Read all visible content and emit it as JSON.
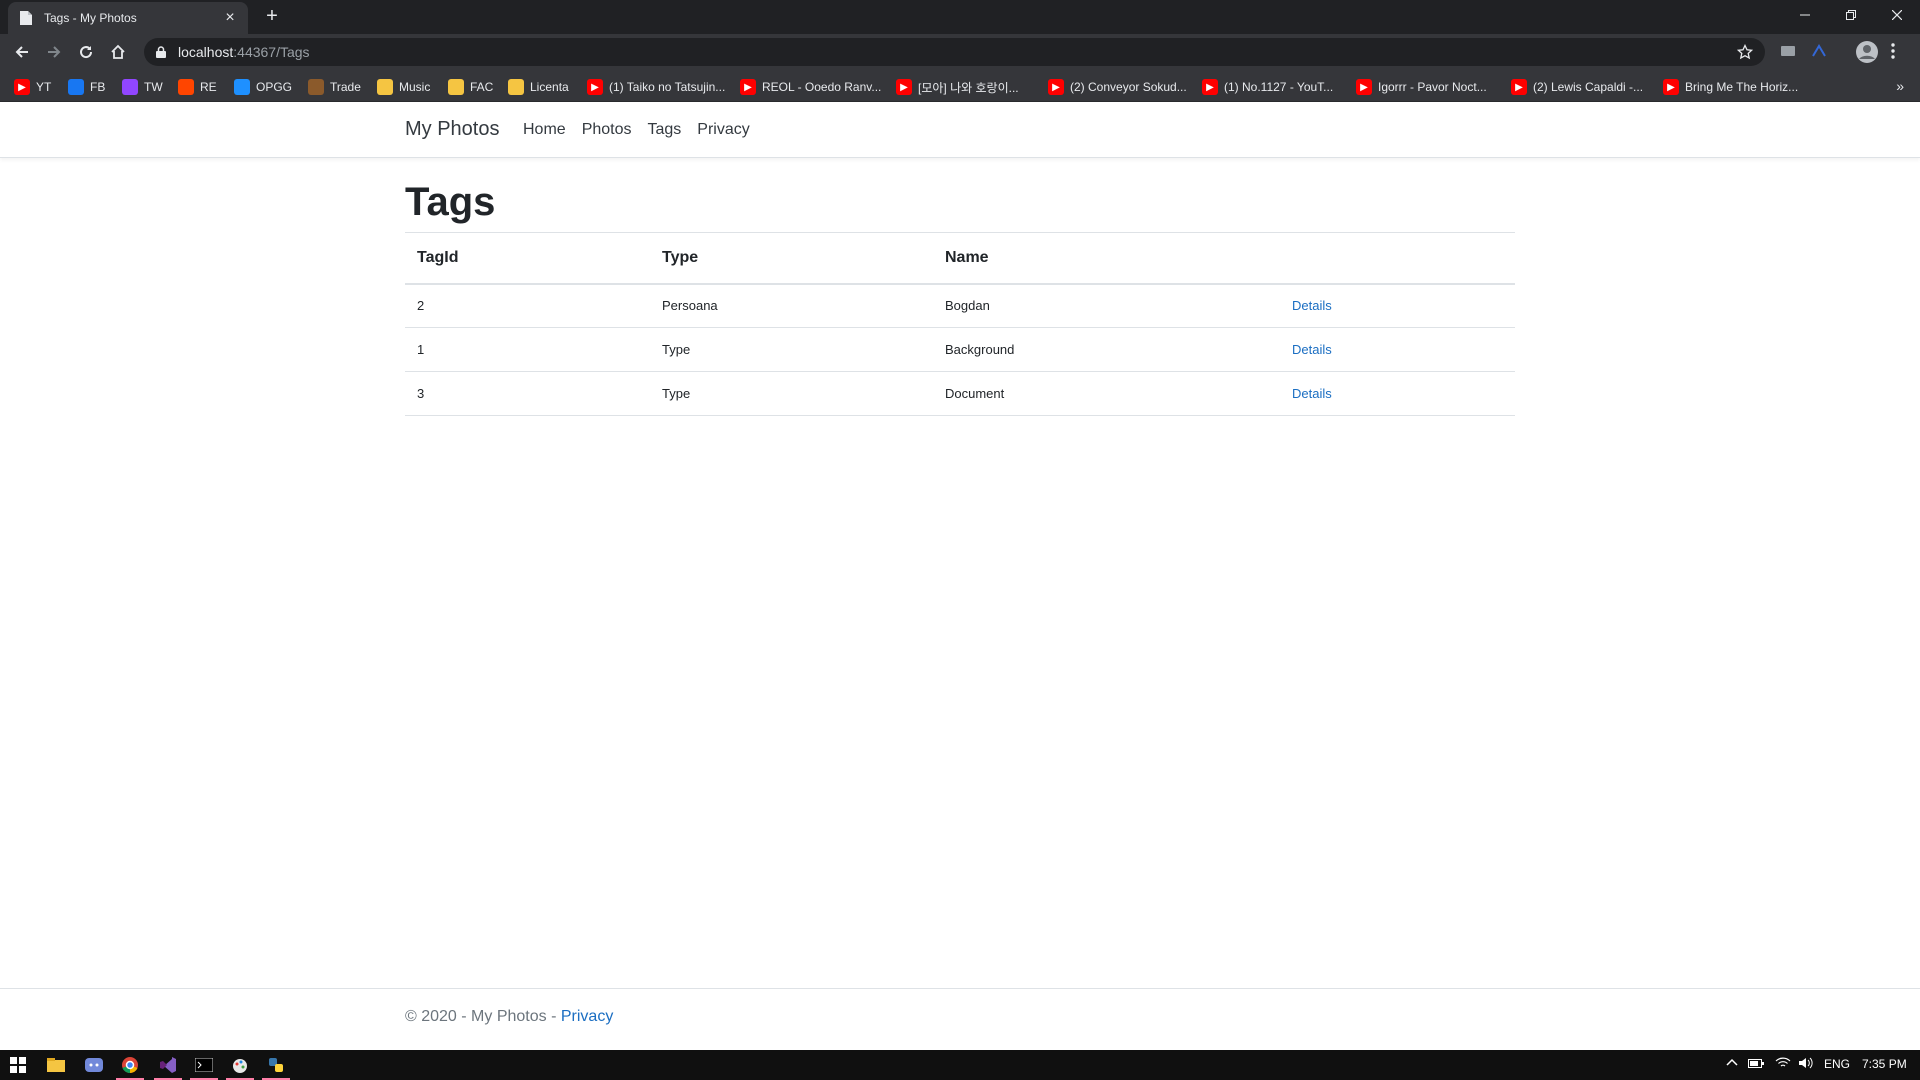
{
  "browser": {
    "tab_title": "Tags - My Photos",
    "url_host": "localhost",
    "url_rest": ":44367/Tags",
    "bookmarks": [
      {
        "label": "YT",
        "icon": "youtube-icon",
        "color": "#ff0000"
      },
      {
        "label": "FB",
        "icon": "facebook-icon",
        "color": "#1877f2"
      },
      {
        "label": "TW",
        "icon": "twitch-icon",
        "color": "#9146ff"
      },
      {
        "label": "RE",
        "icon": "reddit-icon",
        "color": "#ff4500"
      },
      {
        "label": "OPGG",
        "icon": "opgg-icon",
        "color": "#1e90ff"
      },
      {
        "label": "Trade",
        "icon": "trade-icon",
        "color": "#8b5a2b"
      },
      {
        "label": "Music",
        "icon": "folder-icon",
        "color": "#f5c542"
      },
      {
        "label": "FAC",
        "icon": "folder-icon",
        "color": "#f5c542"
      },
      {
        "label": "Licenta",
        "icon": "folder-icon",
        "color": "#f5c542"
      },
      {
        "label": "(1) Taiko no Tatsujin...",
        "icon": "youtube-icon",
        "color": "#ff0000"
      },
      {
        "label": "REOL - Ooedo Ranv...",
        "icon": "youtube-icon",
        "color": "#ff0000"
      },
      {
        "label": "[모아] 나와 호랑이...",
        "icon": "youtube-icon",
        "color": "#ff0000"
      },
      {
        "label": "(2) Conveyor Sokud...",
        "icon": "youtube-icon",
        "color": "#ff0000"
      },
      {
        "label": "(1) No.1127 - YouT...",
        "icon": "youtube-icon",
        "color": "#ff0000"
      },
      {
        "label": "Igorrr - Pavor Noct...",
        "icon": "youtube-icon",
        "color": "#ff0000"
      },
      {
        "label": "(2) Lewis Capaldi -...",
        "icon": "youtube-icon",
        "color": "#ff0000"
      },
      {
        "label": "Bring Me The Horiz...",
        "icon": "youtube-icon",
        "color": "#ff0000"
      }
    ]
  },
  "site": {
    "brand": "My Photos",
    "nav": [
      "Home",
      "Photos",
      "Tags",
      "Privacy"
    ]
  },
  "main": {
    "heading": "Tags",
    "columns": [
      "TagId",
      "Type",
      "Name"
    ],
    "rows": [
      {
        "tagid": "2",
        "type": "Persoana",
        "name": "Bogdan",
        "link": "Details"
      },
      {
        "tagid": "1",
        "type": "Type",
        "name": "Background",
        "link": "Details"
      },
      {
        "tagid": "3",
        "type": "Type",
        "name": "Document",
        "link": "Details"
      }
    ]
  },
  "footer": {
    "text": "© 2020 - My Photos - ",
    "link": "Privacy"
  },
  "taskbar": {
    "lang": "ENG",
    "time": "7:35 PM"
  },
  "colors": {
    "link": "#1b6ec2",
    "chrome_dark": "#202124",
    "chrome_mid": "#35363a"
  }
}
